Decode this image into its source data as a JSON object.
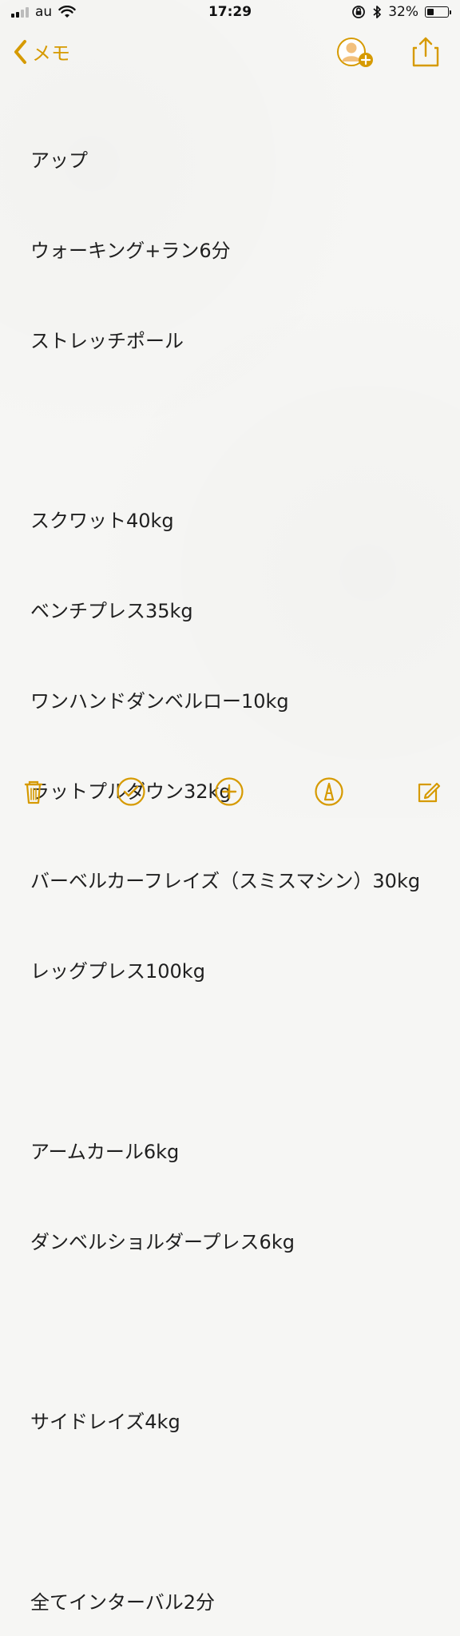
{
  "status": {
    "carrier": "au",
    "time": "17:29",
    "battery_text": "32%"
  },
  "nav": {
    "back_label": "メモ",
    "icons": {
      "back": "chevron-left-icon",
      "avatar": "add-person-icon",
      "share": "share-icon"
    }
  },
  "note": {
    "lines": [
      "アップ",
      "ウォーキング+ラン6分",
      "ストレッチポール",
      "",
      "スクワット40kg",
      "ベンチプレス35kg",
      "ワンハンドダンベルロー10kg",
      "ラットプルダウン32kg",
      "バーベルカーフレイズ（スミスマシン）30kg",
      "レッグプレス100kg",
      "",
      "アームカール6kg",
      "ダンベルショルダープレス6kg",
      "",
      "サイドレイズ4kg",
      "",
      "全てインターバル2分"
    ]
  },
  "toolbar": {
    "icons": [
      "trash-icon",
      "checklist-icon",
      "add-icon",
      "sketch-icon",
      "compose-icon"
    ]
  },
  "colors": {
    "accent": "#d69a00",
    "background": "#f6f6f4",
    "text": "#1f1f1f"
  }
}
